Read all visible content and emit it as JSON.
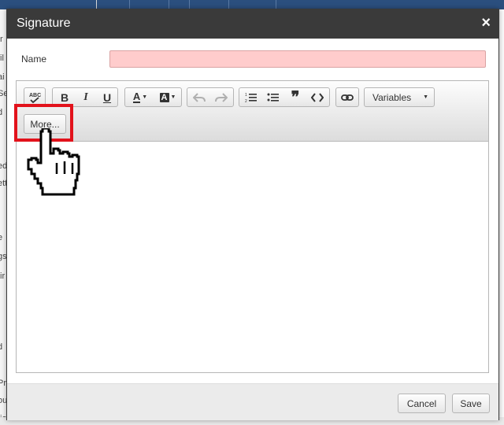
{
  "background": {
    "side_fragments": [
      "tr",
      "fil",
      "ai",
      "Se",
      "d",
      "ed",
      "ett",
      "e",
      "gs",
      "tir",
      "d",
      "Pr",
      "ou",
      "tion"
    ]
  },
  "modal": {
    "title": "Signature",
    "close_glyph": "×"
  },
  "form": {
    "name_label": "Name",
    "name_value": ""
  },
  "toolbar": {
    "spellcheck_label": "ABC",
    "bold": "B",
    "italic": "I",
    "underline": "U",
    "text_color": "A",
    "bg_color": "A",
    "undo": "↶",
    "redo": "↷",
    "ordered_list": "1≡",
    "bullet_list": "•≡",
    "blockquote": "❞",
    "code": "<>",
    "link": "⛓",
    "variables_label": "Variables",
    "more_label": "More..."
  },
  "footer": {
    "cancel_label": "Cancel",
    "save_label": "Save"
  },
  "colors": {
    "header_bg": "#3a3a3a",
    "name_invalid_bg": "#ffcccc",
    "highlight_border": "#e2121b"
  }
}
